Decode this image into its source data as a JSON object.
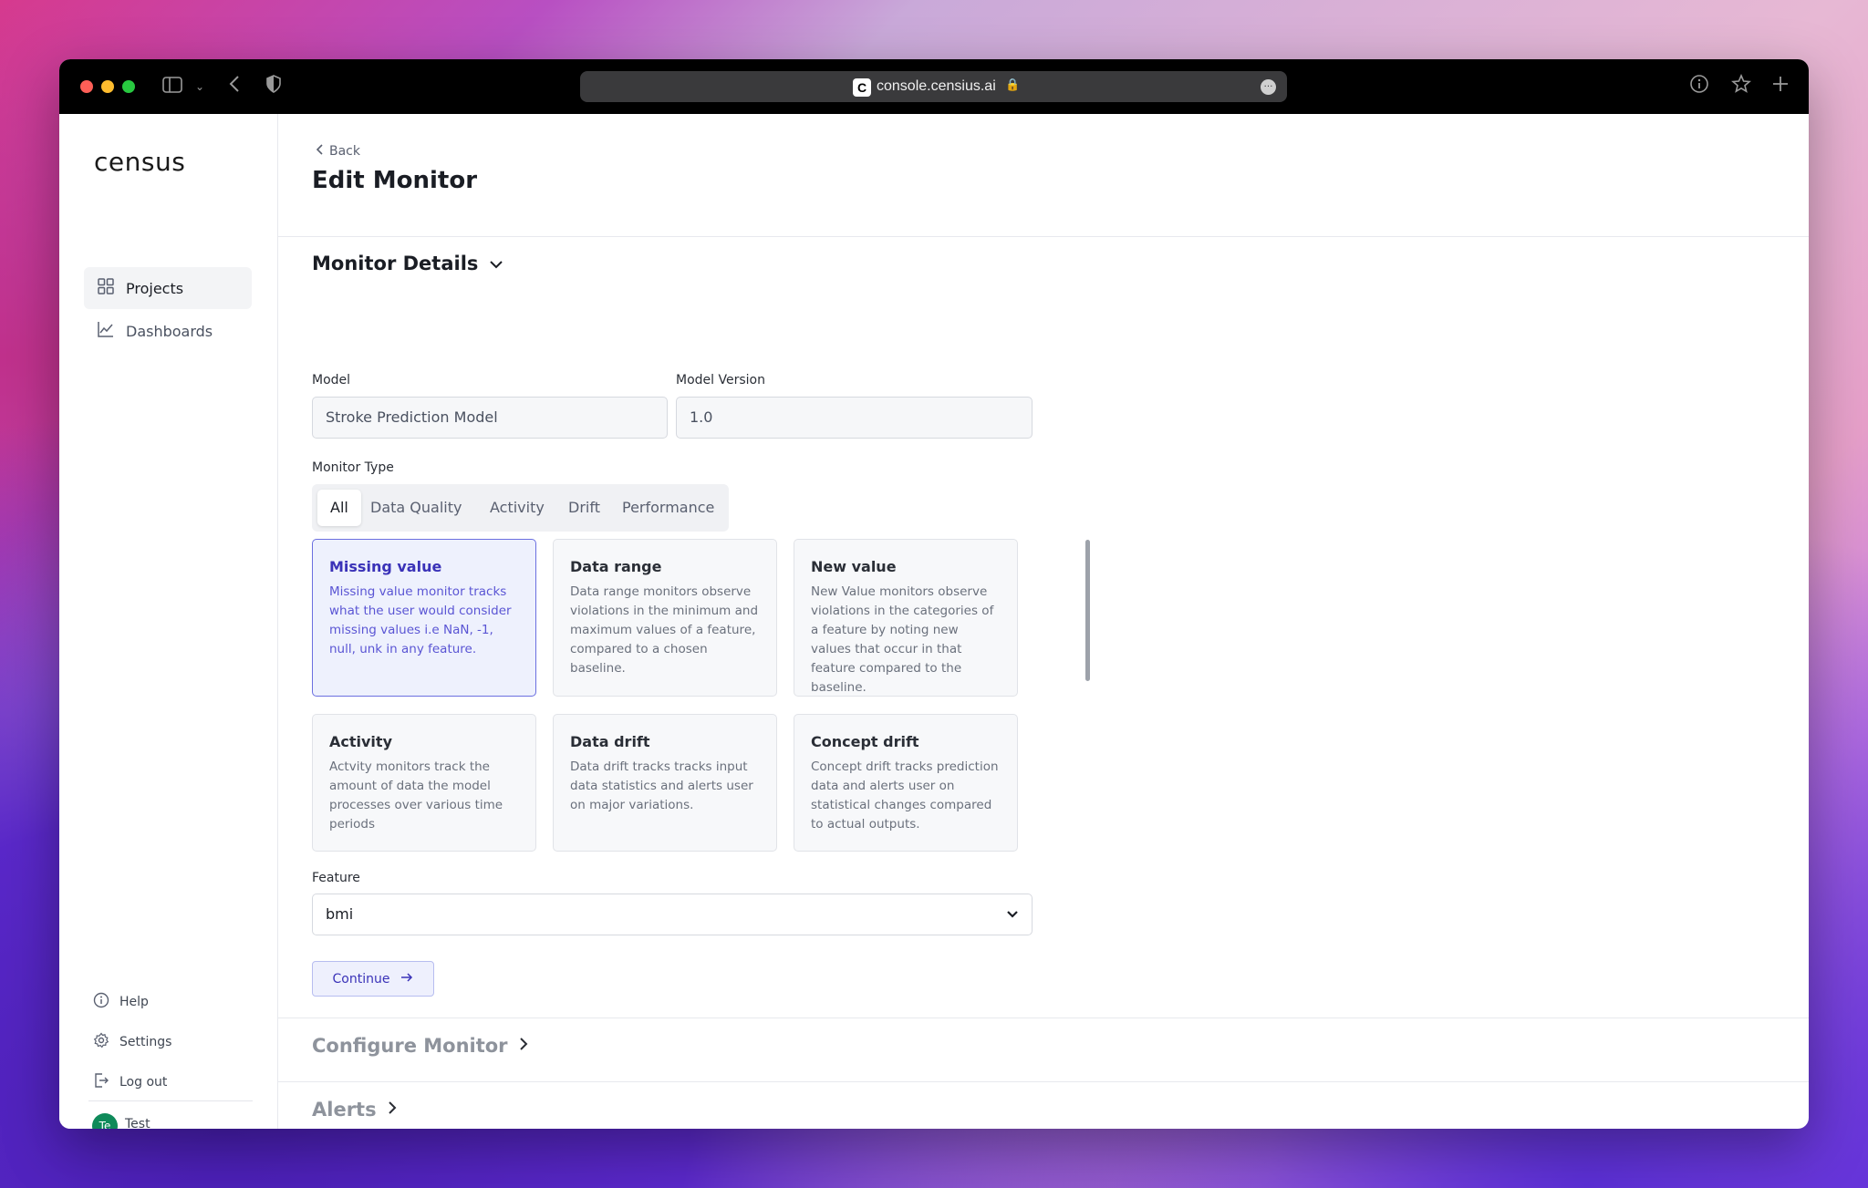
{
  "browser": {
    "url": "console.censius.ai",
    "favicon_letter": "C"
  },
  "sidebar": {
    "logo": "census",
    "nav": [
      {
        "label": "Projects",
        "icon": "grid-icon",
        "active": true
      },
      {
        "label": "Dashboards",
        "icon": "chart-line-icon",
        "active": false
      }
    ],
    "footer": [
      {
        "label": "Help",
        "icon": "info-icon"
      },
      {
        "label": "Settings",
        "icon": "gear-icon"
      },
      {
        "label": "Log out",
        "icon": "logout-icon"
      }
    ],
    "user": {
      "initials": "Te",
      "name": "Test",
      "avatar_color": "#0f8a5a"
    }
  },
  "header": {
    "back_label": "Back",
    "title": "Edit Monitor"
  },
  "monitor_details": {
    "title": "Monitor Details",
    "model_label": "Model",
    "model_value": "Stroke Prediction Model",
    "version_label": "Model Version",
    "version_value": "1.0",
    "type_label": "Monitor Type",
    "tabs": [
      "All",
      "Data Quality",
      "Activity",
      "Drift",
      "Performance"
    ],
    "active_tab": "All",
    "cards": [
      {
        "title": "Missing value",
        "desc": "Missing value monitor tracks what the user would consider missing values i.e NaN, -1, null, unk in any feature.",
        "selected": true
      },
      {
        "title": "Data range",
        "desc": "Data range monitors observe violations in the minimum and maximum values of a feature, compared to a chosen baseline.",
        "selected": false
      },
      {
        "title": "New value",
        "desc": "New Value monitors observe violations in the categories of a feature by noting new values that occur in that feature compared to the baseline.",
        "selected": false
      },
      {
        "title": "Activity",
        "desc": "Actvity monitors track the amount of data the model processes over various time periods",
        "selected": false
      },
      {
        "title": "Data drift",
        "desc": "Data drift tracks tracks input data statistics and alerts user on major variations.",
        "selected": false
      },
      {
        "title": "Concept drift",
        "desc": "Concept drift tracks prediction data and alerts user on statistical changes compared to actual outputs.",
        "selected": false
      }
    ],
    "feature_label": "Feature",
    "feature_value": "bmi",
    "continue_label": "Continue"
  },
  "configure_monitor": {
    "title": "Configure Monitor"
  },
  "alerts": {
    "title": "Alerts"
  },
  "colors": {
    "accent": "#3a32b8",
    "selected_card_bg": "#eef1fd",
    "selected_card_border": "#6b6fe0"
  }
}
